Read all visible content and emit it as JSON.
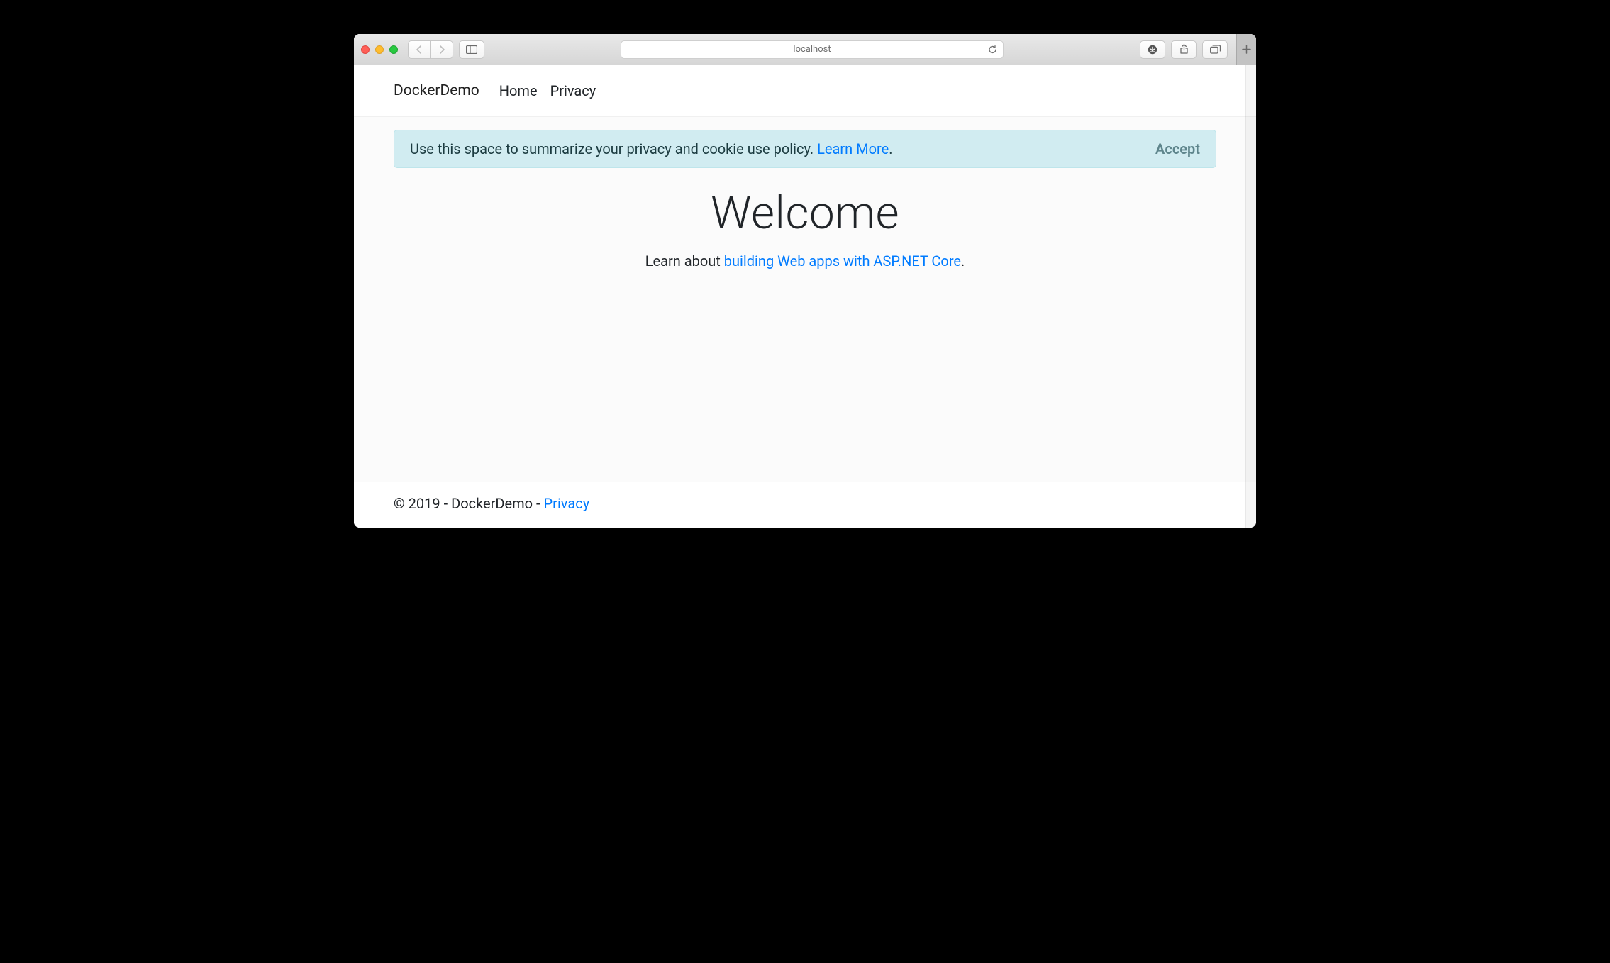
{
  "browser": {
    "address": "localhost",
    "icons": {
      "back": "chevron-left-icon",
      "forward": "chevron-right-icon",
      "sidebar": "sidebar-icon",
      "reload": "reload-icon",
      "downloads": "download-icon",
      "share": "share-icon",
      "tabs": "tabs-icon",
      "new_tab": "plus-icon"
    }
  },
  "navbar": {
    "brand": "DockerDemo",
    "links": [
      {
        "label": "Home"
      },
      {
        "label": "Privacy"
      }
    ]
  },
  "alert": {
    "text": "Use this space to summarize your privacy and cookie use policy. ",
    "learn_more": "Learn More",
    "period": ".",
    "accept": "Accept"
  },
  "hero": {
    "title": "Welcome",
    "lead_prefix": "Learn about ",
    "lead_link": "building Web apps with ASP.NET Core",
    "lead_suffix": "."
  },
  "footer": {
    "text": "© 2019 - DockerDemo - ",
    "privacy": "Privacy"
  },
  "colors": {
    "link": "#007bff",
    "alert_bg": "#d1ecf1"
  }
}
